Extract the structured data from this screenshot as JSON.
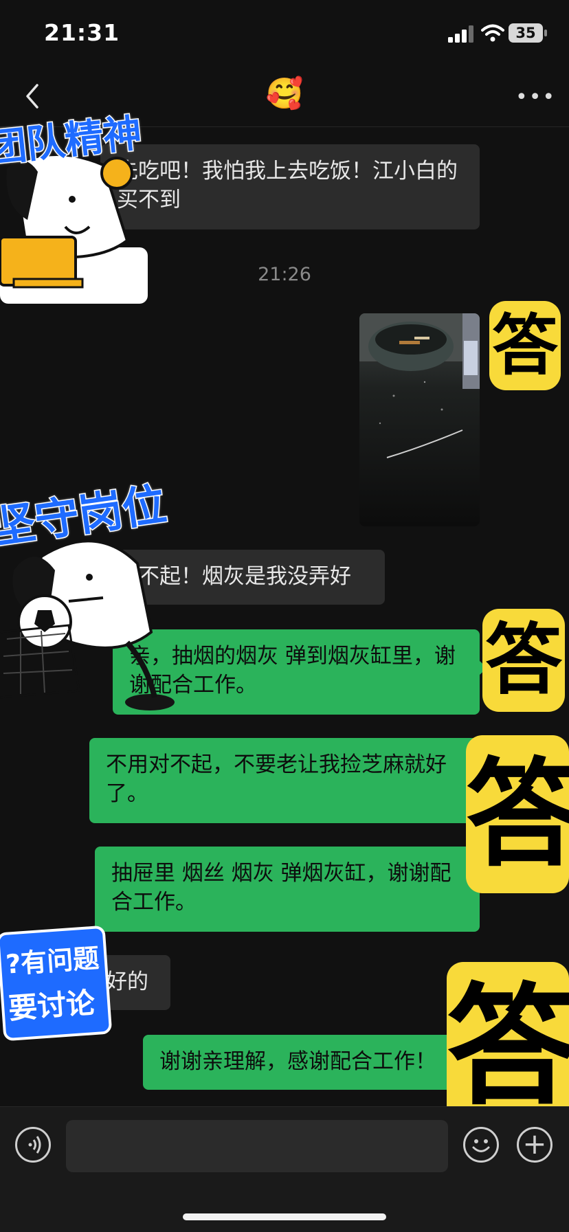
{
  "status_bar": {
    "time": "21:31",
    "battery": "35"
  },
  "nav": {
    "title": "🥰",
    "more": "•••"
  },
  "messages": [
    {
      "side": "in",
      "text": "先吃吧！我怕我上去吃饭！江小白的买不到"
    },
    {
      "side": "in",
      "text": "对不起！烟灰是我没弄好"
    },
    {
      "side": "out",
      "text": "亲，抽烟的烟灰 弹到烟灰缸里，谢谢配合工作。"
    },
    {
      "side": "out",
      "text": "不用对不起，不要老让我捡芝麻就好了。"
    },
    {
      "side": "out",
      "text": "抽屉里 烟丝 烟灰 弹烟灰缸，谢谢配合工作。"
    },
    {
      "side": "in",
      "text": "好的"
    },
    {
      "side": "out",
      "text": "谢谢亲理解，感谢配合工作！"
    }
  ],
  "timestamp": "21:26",
  "stickers": {
    "team_spirit": "团队精神",
    "stick_to_post": "坚守岗位",
    "question": "?有问题",
    "discuss": "要讨论",
    "answer": "答"
  },
  "colors": {
    "background": "#111111",
    "outgoing": "#2bb35b",
    "incoming": "#2c2c2c",
    "sticker_blue": "#1e6bff",
    "sticker_yellow": "#f8da3a"
  }
}
